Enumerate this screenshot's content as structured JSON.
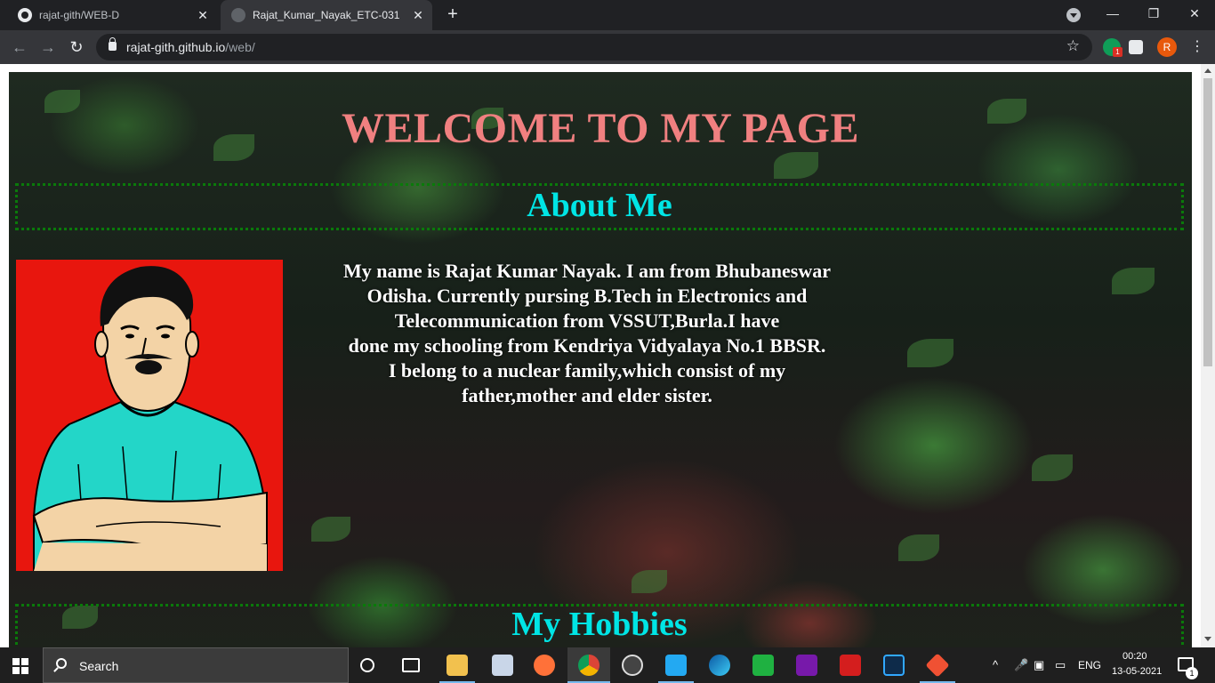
{
  "browser": {
    "tabs": [
      {
        "title": "rajat-gith/WEB-D",
        "close": "✕"
      },
      {
        "title": "Rajat_Kumar_Nayak_ETC-031",
        "close": "✕"
      }
    ],
    "new_tab": "+",
    "window_controls": {
      "minimize": "—",
      "restore": "❐",
      "close": "✕"
    },
    "nav": {
      "back": "←",
      "forward": "→",
      "reload": "↻"
    },
    "url": {
      "domain": "rajat-gith.github.io",
      "path": "/web/"
    },
    "bookmark_star": "☆",
    "extension_badge": "1",
    "profile_initial": "R"
  },
  "page": {
    "welcome": "WELCOME TO MY PAGE",
    "about_title": "About Me",
    "about_lines": [
      "My name is Rajat Kumar Nayak. I am from Bhubaneswar",
      "Odisha. Currently pursing B.Tech in Electronics and",
      "Telecommunication from VSSUT,Burla.I have",
      "done my schooling from Kendriya Vidyalaya No.1 BBSR.",
      "I belong to a nuclear family,which consist of my",
      "father,mother and elder sister."
    ],
    "hobbies_title": "My Hobbies",
    "colors": {
      "welcome": "#f08080",
      "section_title": "#00e5e5",
      "border": "#0a7a0a",
      "portrait_bg": "#e8160e"
    }
  },
  "taskbar": {
    "search_placeholder": "Search",
    "language": "ENG",
    "time": "00:20",
    "date": "13-05-2021",
    "notification_count": "1",
    "pinned_icons": [
      "task-view-icon",
      "file-explorer-icon",
      "paint-icon",
      "firefox-icon",
      "chrome-icon",
      "obs-icon",
      "vscode-icon",
      "edge-icon",
      "evernote-icon",
      "onenote-icon",
      "acrobat-icon",
      "photoshop-icon",
      "git-icon"
    ]
  }
}
